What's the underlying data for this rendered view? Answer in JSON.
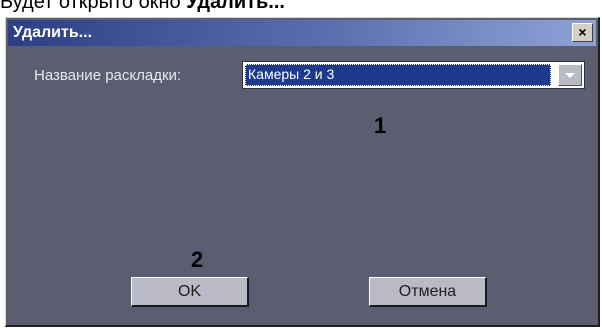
{
  "document": {
    "intro_text": "Будет открыто окно ",
    "intro_bold": "Удалить..."
  },
  "window": {
    "title": "Удалить...",
    "close_glyph": "×"
  },
  "form": {
    "layout_name_label": "Название раскладки:",
    "layout_name_value": "Камеры 2 и 3"
  },
  "annotations": {
    "marker_1": "1",
    "marker_2": "2"
  },
  "buttons": {
    "ok_label": "OK",
    "cancel_label": "Отмена"
  },
  "colors": {
    "dialog_bg": "#5b5d70",
    "titlebar_start": "#2c3f85",
    "selection": "#1c3b8f"
  }
}
